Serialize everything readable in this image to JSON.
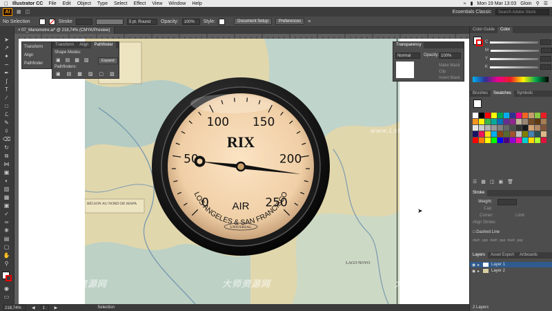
{
  "menubar": {
    "app_name": "Illustrator CC",
    "items": [
      "File",
      "Edit",
      "Object",
      "Type",
      "Select",
      "Effect",
      "View",
      "Window",
      "Help"
    ],
    "clock": "Mon 19 Mar 13:03",
    "user": "Gloin"
  },
  "appbar": {
    "logo": "Ai",
    "workspace": "Essentials Classic",
    "search_placeholder": "Search Adobe Stock"
  },
  "control_bar": {
    "selection": "No Selection",
    "stroke_label": "Stroke",
    "brush": "5 pt. Round",
    "opacity_label": "Opacity:",
    "opacity_value": "100%",
    "style_label": "Style:",
    "doc_setup": "Document Setup",
    "preferences": "Preferences"
  },
  "document_tab": {
    "title": "07_Manometre.ai* @ 218,74% (CMYK/Preview)"
  },
  "floating_panel": {
    "side_items": [
      "Transform",
      "Align",
      "Pathfinder"
    ],
    "tabs": [
      "Transform",
      "Align",
      "Pathfinder"
    ],
    "shape_modes_label": "Shape Modes:",
    "expand_label": "Expand",
    "pathfinders_label": "Pathfinders:"
  },
  "transparency_panel": {
    "title": "Transparency",
    "blend_mode": "Normal",
    "opacity_label": "Opacity:",
    "opacity_value": "100%",
    "make_mask": "Make Mask",
    "clip": "Clip",
    "invert_mask": "Invert Mask"
  },
  "color_panel": {
    "tabs": [
      "Color Guide",
      "Color"
    ],
    "channels": [
      "C",
      "M",
      "Y",
      "K"
    ]
  },
  "swatches_panel": {
    "tabs": [
      "Brushes",
      "Swatches",
      "Symbols"
    ],
    "colors": [
      "#ffffff",
      "#000000",
      "#ff0000",
      "#ffff00",
      "#00a651",
      "#00aeef",
      "#2e3192",
      "#ec008c",
      "#f26522",
      "#c69c6d",
      "#8dc63f",
      "#ed1c24",
      "#f7941d",
      "#fff200",
      "#39b54a",
      "#00a99d",
      "#0072bc",
      "#662d91",
      "#92278f",
      "#c2b59b",
      "#998675",
      "#754c24",
      "#603913",
      "#a67c52",
      "#e6e6e6",
      "#cccccc",
      "#b3b3b3",
      "#999999",
      "#808080",
      "#666666",
      "#4d4d4d",
      "#333333",
      "#1a1a1a",
      "#d4a373",
      "#b08968",
      "#7f5539",
      "#1b1464",
      "#ed145b",
      "#ffde17",
      "#00aeef",
      "#8b4513",
      "#556b2f",
      "#a0522d",
      "#c0c0c0",
      "#808000",
      "#4682b4",
      "#2f4f4f",
      "#deb887",
      "#ff0000",
      "#ff7f00",
      "#ffff00",
      "#00ff00",
      "#0000ff",
      "#4b0082",
      "#9400d3",
      "#ff1493",
      "#00ced1",
      "#ffd700",
      "#adff2f",
      "#dc143c"
    ]
  },
  "stroke_panel": {
    "title": "Stroke",
    "weight_label": "Weight:",
    "cap_label": "Cap:",
    "corner_label": "Corner:",
    "limit_label": "Limit:",
    "align_label": "Align Stroke:",
    "dashed_line_label": "Dashed Line",
    "dash_labels": [
      "dash",
      "gap",
      "dash",
      "gap",
      "dash",
      "gap"
    ]
  },
  "layers_panel": {
    "tabs": [
      "Layers",
      "Asset Export",
      "Artboards"
    ],
    "layers": [
      "Layer 1",
      "Layer 2"
    ],
    "count": "2 Layers"
  },
  "statusbar": {
    "zoom": "218,74%",
    "page": "1",
    "tool": "Selection"
  },
  "gauge": {
    "brand": "RIX",
    "subtitle": "LOS ANGELES & SAN FRANCISCO",
    "medium": "AIR",
    "maker": "UNIVERSAL",
    "ticks": [
      "0",
      "50",
      "100",
      "150",
      "200",
      "250"
    ],
    "value": 215,
    "range": [
      0,
      250
    ]
  },
  "map_labels": {
    "region": "RÉGION AU NORD DE MAPA",
    "lake": "LAGO NOVO"
  },
  "watermarks": {
    "text_cn": "大师资源网",
    "url": "www.Lshipd.com",
    "suffix": ".com"
  },
  "colors": {
    "ui_dark": "#3a3a3a",
    "ui_panel": "#4d4d4d",
    "gauge_face": "#f3d2a8",
    "gauge_bezel": "#111111",
    "needle": "#111111"
  }
}
